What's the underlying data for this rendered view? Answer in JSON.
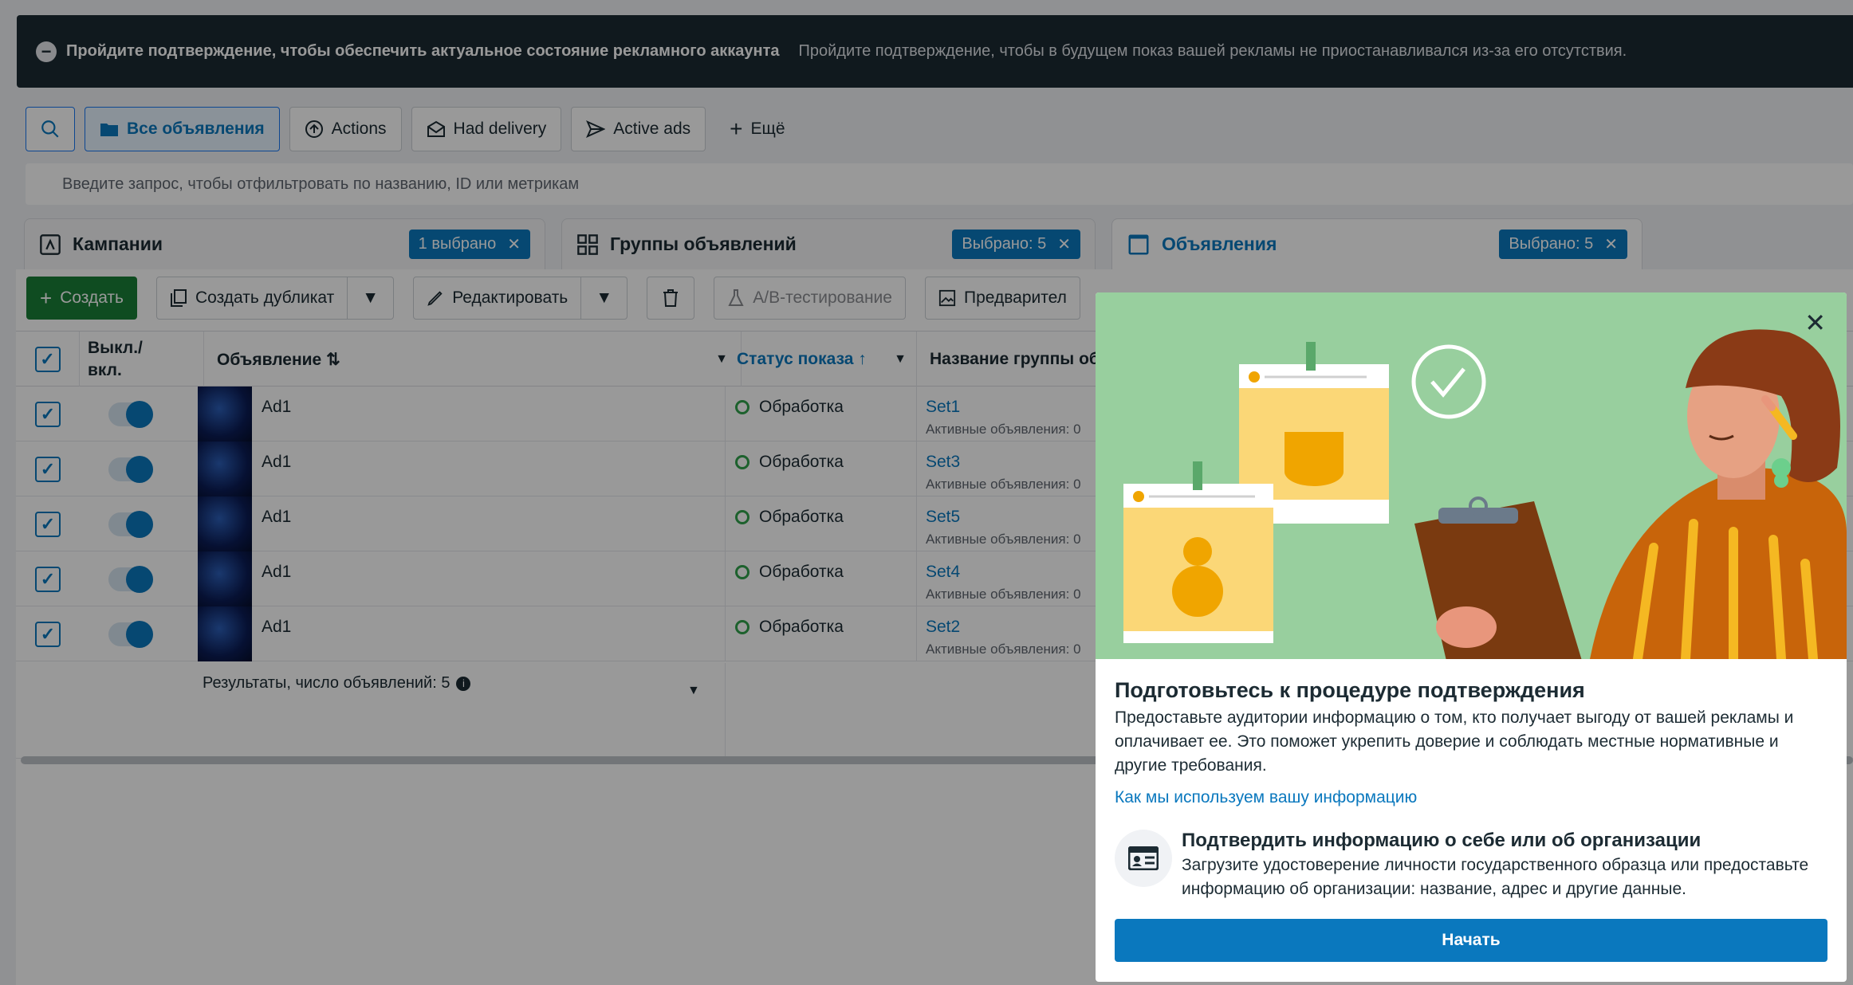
{
  "banner": {
    "title": "Пройдите подтверждение, чтобы обеспечить актуальное состояние рекламного аккаунта",
    "desc": "Пройдите подтверждение, чтобы в будущем показ вашей рекламы не приостанавливался из-за его отсутствия."
  },
  "filters": {
    "all_ads": "Все объявления",
    "actions": "Actions",
    "had_delivery": "Had delivery",
    "active_ads": "Active ads",
    "more": "Ещё"
  },
  "search": {
    "placeholder": "Введите запрос, чтобы отфильтровать по названию, ID или метрикам"
  },
  "tabs": [
    {
      "label": "Кампании",
      "chip": "1 выбрано"
    },
    {
      "label": "Группы объявлений",
      "chip": "Выбрано: 5"
    },
    {
      "label": "Объявления",
      "chip": "Выбрано: 5"
    }
  ],
  "toolbar": {
    "create": "Создать",
    "duplicate": "Создать дубликат",
    "edit": "Редактировать",
    "ab_test": "A/B-тестирование",
    "preview": "Предварител"
  },
  "table": {
    "headers": {
      "toggle": "Выкл./ вкл.",
      "ad": "Объявление",
      "status": "Статус показа",
      "adset": "Название группы об"
    },
    "rows": [
      {
        "ad": "Ad1",
        "status": "Обработка",
        "adset": "Set1",
        "sub": "Активные объявления: 0"
      },
      {
        "ad": "Ad1",
        "status": "Обработка",
        "adset": "Set3",
        "sub": "Активные объявления: 0"
      },
      {
        "ad": "Ad1",
        "status": "Обработка",
        "adset": "Set5",
        "sub": "Активные объявления: 0"
      },
      {
        "ad": "Ad1",
        "status": "Обработка",
        "adset": "Set4",
        "sub": "Активные объявления: 0"
      },
      {
        "ad": "Ad1",
        "status": "Обработка",
        "adset": "Set2",
        "sub": "Активные объявления: 0"
      }
    ],
    "footer": "Результаты, число объявлений: 5"
  },
  "modal": {
    "title": "Подготовьтесь к процедуре подтверждения",
    "body": "Предоставьте аудитории информацию о том, кто получает выгоду от вашей рекламы и оплачивает ее. Это поможет укрепить доверие и соблюдать местные нормативные и другие требования.",
    "link": "Как мы используем вашу информацию",
    "option_title": "Подтвердить информацию о себе или об организации",
    "option_desc": "Загрузите удостоверение личности государственного образца или предоставьте информацию об организации: название, адрес и другие данные.",
    "button": "Начать"
  },
  "colors": {
    "accent": "#0a78be",
    "create_green": "#1a7f37",
    "banner_bg": "#1c2b33",
    "illustration_bg": "#98cf9e"
  }
}
